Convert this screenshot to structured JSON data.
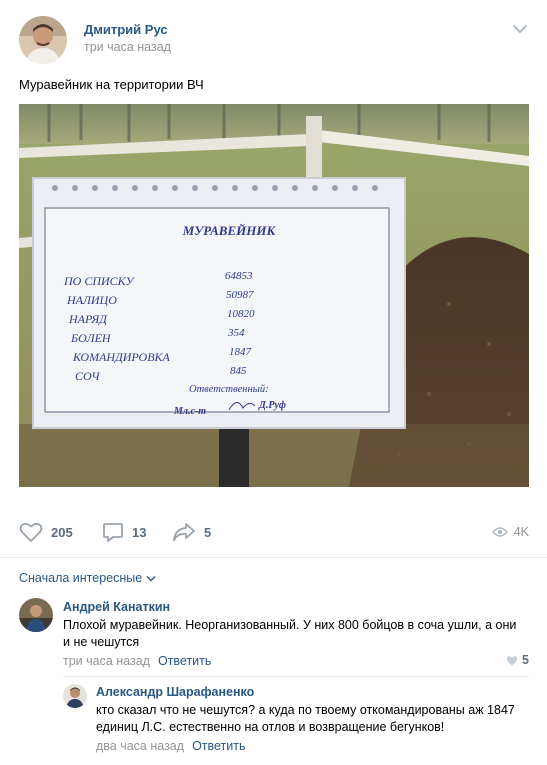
{
  "post": {
    "author": "Дмитрий Рус",
    "time": "три часа назад",
    "text": "Муравейник на территории ВЧ"
  },
  "sign": {
    "title": "МУРАВЕЙНИК",
    "rows": [
      {
        "label": "ПО СПИСКУ",
        "value": "64853"
      },
      {
        "label": "НАЛИЦО",
        "value": "50987"
      },
      {
        "label": "НАРЯД",
        "value": "10820"
      },
      {
        "label": "БОЛЕН",
        "value": "354"
      },
      {
        "label": "КОМАНДИРОВКА",
        "value": "1847"
      },
      {
        "label": "СОЧ",
        "value": "845"
      }
    ],
    "responsible_label": "Ответственный:",
    "rank": "Мл.с-т",
    "name": "Д.Руф"
  },
  "actions": {
    "likes": "205",
    "comments": "13",
    "shares": "5",
    "views": "4K"
  },
  "comments_sort": "Сначала интересные",
  "comments": [
    {
      "author": "Андрей Канаткин",
      "text": "Плохой муравейник. Неорганизованный. У них 800 бойцов в соча ушли, а они и не чешутся",
      "time": "три часа назад",
      "reply_label": "Ответить",
      "likes": "5"
    },
    {
      "author": "Александр Шарафаненко",
      "text": "кто сказал что не чешутся? а куда по твоему откомандированы аж 1847 единиц Л.С. естественно на отлов и возвращение бегунков!",
      "time": "два часа назад",
      "reply_label": "Ответить"
    }
  ],
  "colors": {
    "link": "#2a5885",
    "muted": "#939393",
    "action": "#5a6d82"
  }
}
